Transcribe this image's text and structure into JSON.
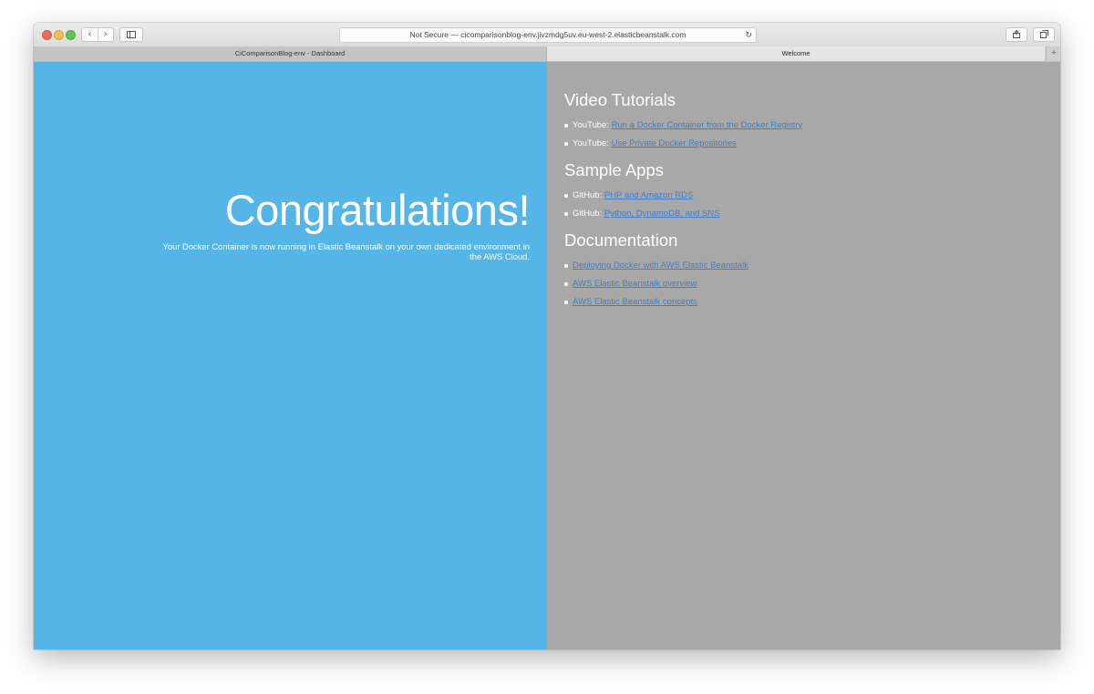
{
  "browser": {
    "address_text": "Not Secure — cicomparisonblog-env.jivzmdg5uv.eu-west-2.elasticbeanstalk.com",
    "tabs": [
      {
        "label": "CiComparisonBlog-env - Dashboard",
        "active": false
      },
      {
        "label": "Welcome",
        "active": true
      }
    ],
    "new_tab_symbol": "+"
  },
  "left": {
    "title": "Congratulations!",
    "subtitle": "Your Docker Container is now running in Elastic Beanstalk on your own dedicated environment in the AWS Cloud."
  },
  "right": {
    "sections": [
      {
        "title": "Video Tutorials",
        "items": [
          {
            "prefix": "YouTube:",
            "link": "Run a Docker Container from the Docker Registry"
          },
          {
            "prefix": "YouTube:",
            "link": "Use Private Docker Repositories"
          }
        ]
      },
      {
        "title": "Sample Apps",
        "items": [
          {
            "prefix": "GitHub:",
            "link": "PHP and Amazon RDS"
          },
          {
            "prefix": "GitHub:",
            "link": "Python, DynamoDB, and SNS"
          }
        ]
      },
      {
        "title": "Documentation",
        "items": [
          {
            "prefix": "",
            "link": "Deploying Docker with AWS Elastic Beanstalk"
          },
          {
            "prefix": "",
            "link": "AWS Elastic Beanstalk overview"
          },
          {
            "prefix": "",
            "link": "AWS Elastic Beanstalk concepts"
          }
        ]
      }
    ]
  },
  "colors": {
    "left_pane_bg": "#55b5e7",
    "right_pane_bg": "#a8a8a8",
    "link": "#3f7fc9"
  }
}
